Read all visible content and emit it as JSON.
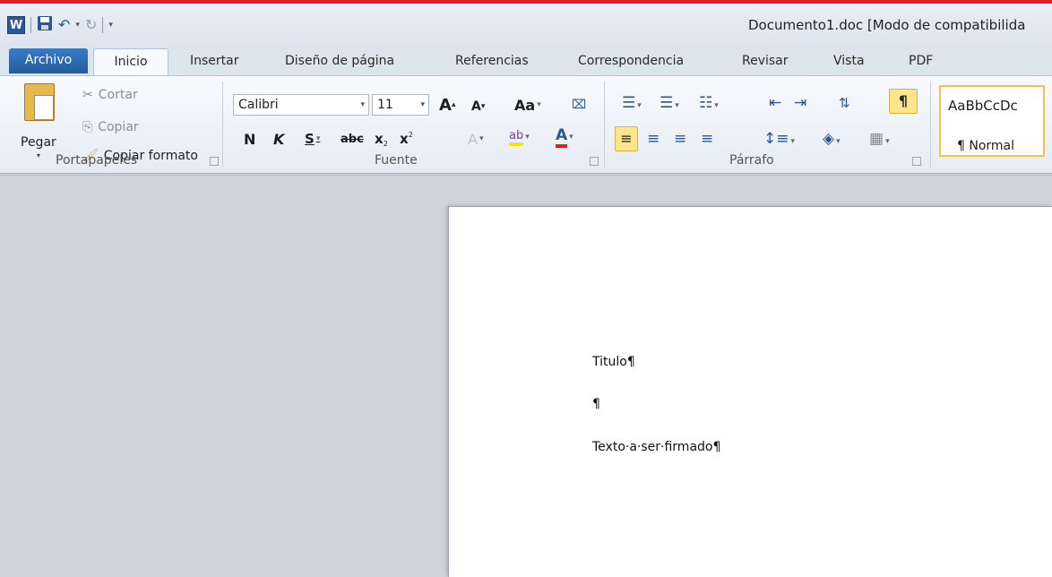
{
  "window": {
    "title": "Documento1.doc [Modo de compatibilida",
    "logo_letter": "W"
  },
  "quick_access": {
    "save_icon": "save-icon",
    "undo_icon": "undo-icon",
    "redo_icon": "redo-icon",
    "customize_icon": "customize-qat-icon"
  },
  "tabs": {
    "file": "Archivo",
    "home": "Inicio",
    "insert": "Insertar",
    "layout": "Diseño de página",
    "references": "Referencias",
    "mailings": "Correspondencia",
    "review": "Revisar",
    "view": "Vista",
    "pdf": "PDF"
  },
  "clipboard": {
    "paste": "Pegar",
    "cut": "Cortar",
    "copy": "Copiar",
    "format_painter": "Copiar formato",
    "group_label": "Portapapeles"
  },
  "font": {
    "family": "Calibri",
    "size": "11",
    "grow": "A",
    "shrink": "A",
    "change_case": "Aa",
    "bold": "N",
    "italic": "K",
    "underline": "S",
    "strikethrough": "abc",
    "subscript": "x",
    "superscript": "x",
    "highlight": "ab",
    "font_color": "A",
    "group_label": "Fuente",
    "highlight_color": "#f7e31b",
    "font_color_value": "#e02020"
  },
  "paragraph": {
    "show_marks": "¶",
    "group_label": "Párrafo"
  },
  "styles": {
    "sample": "AaBbCcDc",
    "name": "¶ Normal"
  },
  "document": {
    "line1": "Titulo¶",
    "line2": "¶",
    "line3": "Texto·a·ser·firmado¶"
  }
}
